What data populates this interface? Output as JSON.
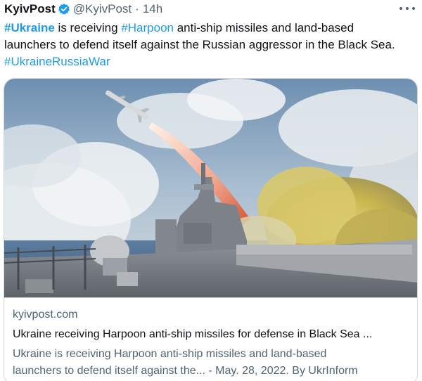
{
  "tweet": {
    "author_name": "KyivPost",
    "handle": "@KyivPost",
    "separator": "·",
    "time": "14h",
    "text": {
      "line1": {
        "tag1": "#Ukraine",
        "t1": " is receiving ",
        "tag2": "#Harpoon",
        "t2": " anti-ship missiles and land-based"
      },
      "line2": "launchers to defend itself against the Russian aggressor in the Black Sea.",
      "line3_tag": "#UkraineRussiaWar"
    },
    "icons": {
      "verified": "verified-badge-icon",
      "more": "more-options-icon"
    },
    "colors": {
      "link": "#1d9bf0",
      "secondary": "#536471",
      "text": "#0f1419"
    }
  },
  "card": {
    "image_subject": "warship launching anti-ship missile at sea",
    "domain": "kyivpost.com",
    "title": "Ukraine receiving Harpoon anti-ship missiles for defense in Black Sea ...",
    "description_line1": "Ukraine is receiving Harpoon anti-ship missiles and land-based",
    "description_line2": "launchers to defend itself against the... - May. 28, 2022. By UkrInform"
  }
}
